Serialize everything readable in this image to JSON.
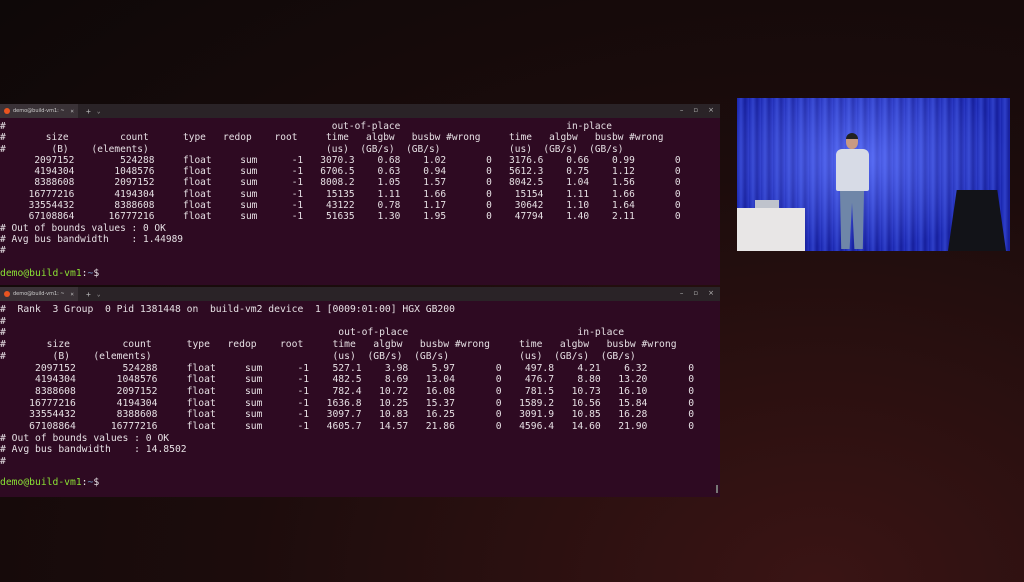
{
  "terminal_top": {
    "tab_title": "demo@build-vm1: ~",
    "header_lines": [
      "#",
      "#       size         count      type   redop    root     time   algbw   busbw #wrong     time   algbw   busbw #wrong",
      "#        (B)    (elements)                               (us)  (GB/s)  (GB/s)            (us)  (GB/s)  (GB/s)"
    ],
    "group_labels": {
      "out": "out-of-place",
      "in": "in-place"
    },
    "rows": [
      [
        "2097152",
        "524288",
        "float",
        "sum",
        "-1",
        "3070.3",
        "0.68",
        "1.02",
        "0",
        "3176.6",
        "0.66",
        "0.99",
        "0"
      ],
      [
        "4194304",
        "1048576",
        "float",
        "sum",
        "-1",
        "6706.5",
        "0.63",
        "0.94",
        "0",
        "5612.3",
        "0.75",
        "1.12",
        "0"
      ],
      [
        "8388608",
        "2097152",
        "float",
        "sum",
        "-1",
        "8008.2",
        "1.05",
        "1.57",
        "0",
        "8042.5",
        "1.04",
        "1.56",
        "0"
      ],
      [
        "16777216",
        "4194304",
        "float",
        "sum",
        "-1",
        "15135",
        "1.11",
        "1.66",
        "0",
        "15154",
        "1.11",
        "1.66",
        "0"
      ],
      [
        "33554432",
        "8388608",
        "float",
        "sum",
        "-1",
        "43122",
        "0.78",
        "1.17",
        "0",
        "30642",
        "1.10",
        "1.64",
        "0"
      ],
      [
        "67108864",
        "16777216",
        "float",
        "sum",
        "-1",
        "51635",
        "1.30",
        "1.95",
        "0",
        "47794",
        "1.40",
        "2.11",
        "0"
      ]
    ],
    "footer_lines": [
      "# Out of bounds values : 0 OK",
      "# Avg bus bandwidth    : 1.44989",
      "#"
    ],
    "prompt": {
      "user": "demo@build-vm1",
      "sep": ":",
      "path": "~",
      "sym": "$"
    }
  },
  "terminal_bottom": {
    "tab_title": "demo@build-vm1: ~",
    "pre_lines": [
      "#  Rank  3 Group  0 Pid 1381448 on  build-vm2 device  1 [0009:01:00] HGX GB200",
      "#"
    ],
    "header_lines": [
      "#",
      "#       size         count      type   redop    root     time   algbw   busbw #wrong     time   algbw   busbw #wrong",
      "#        (B)    (elements)                               (us)  (GB/s)  (GB/s)            (us)  (GB/s)  (GB/s)"
    ],
    "group_labels": {
      "out": "out-of-place",
      "in": "in-place"
    },
    "rows": [
      [
        "2097152",
        "524288",
        "float",
        "sum",
        "-1",
        "527.1",
        "3.98",
        "5.97",
        "0",
        "497.8",
        "4.21",
        "6.32",
        "0"
      ],
      [
        "4194304",
        "1048576",
        "float",
        "sum",
        "-1",
        "482.5",
        "8.69",
        "13.04",
        "0",
        "476.7",
        "8.80",
        "13.20",
        "0"
      ],
      [
        "8388608",
        "2097152",
        "float",
        "sum",
        "-1",
        "782.4",
        "10.72",
        "16.08",
        "0",
        "781.5",
        "10.73",
        "16.10",
        "0"
      ],
      [
        "16777216",
        "4194304",
        "float",
        "sum",
        "-1",
        "1636.8",
        "10.25",
        "15.37",
        "0",
        "1589.2",
        "10.56",
        "15.84",
        "0"
      ],
      [
        "33554432",
        "8388608",
        "float",
        "sum",
        "-1",
        "3097.7",
        "10.83",
        "16.25",
        "0",
        "3091.9",
        "10.85",
        "16.28",
        "0"
      ],
      [
        "67108864",
        "16777216",
        "float",
        "sum",
        "-1",
        "4605.7",
        "14.57",
        "21.86",
        "0",
        "4596.4",
        "14.60",
        "21.90",
        "0"
      ]
    ],
    "footer_lines": [
      "# Out of bounds values : 0 OK",
      "# Avg bus bandwidth    : 14.8502",
      "#"
    ],
    "prompt": {
      "user": "demo@build-vm1",
      "sep": ":",
      "path": "~",
      "sym": "$"
    }
  },
  "window_controls": {
    "minimize": "–",
    "maximize": "▫",
    "close": "×"
  },
  "tab_controls": {
    "new_tab": "+",
    "dropdown": "⌄",
    "close_tab": "×"
  }
}
